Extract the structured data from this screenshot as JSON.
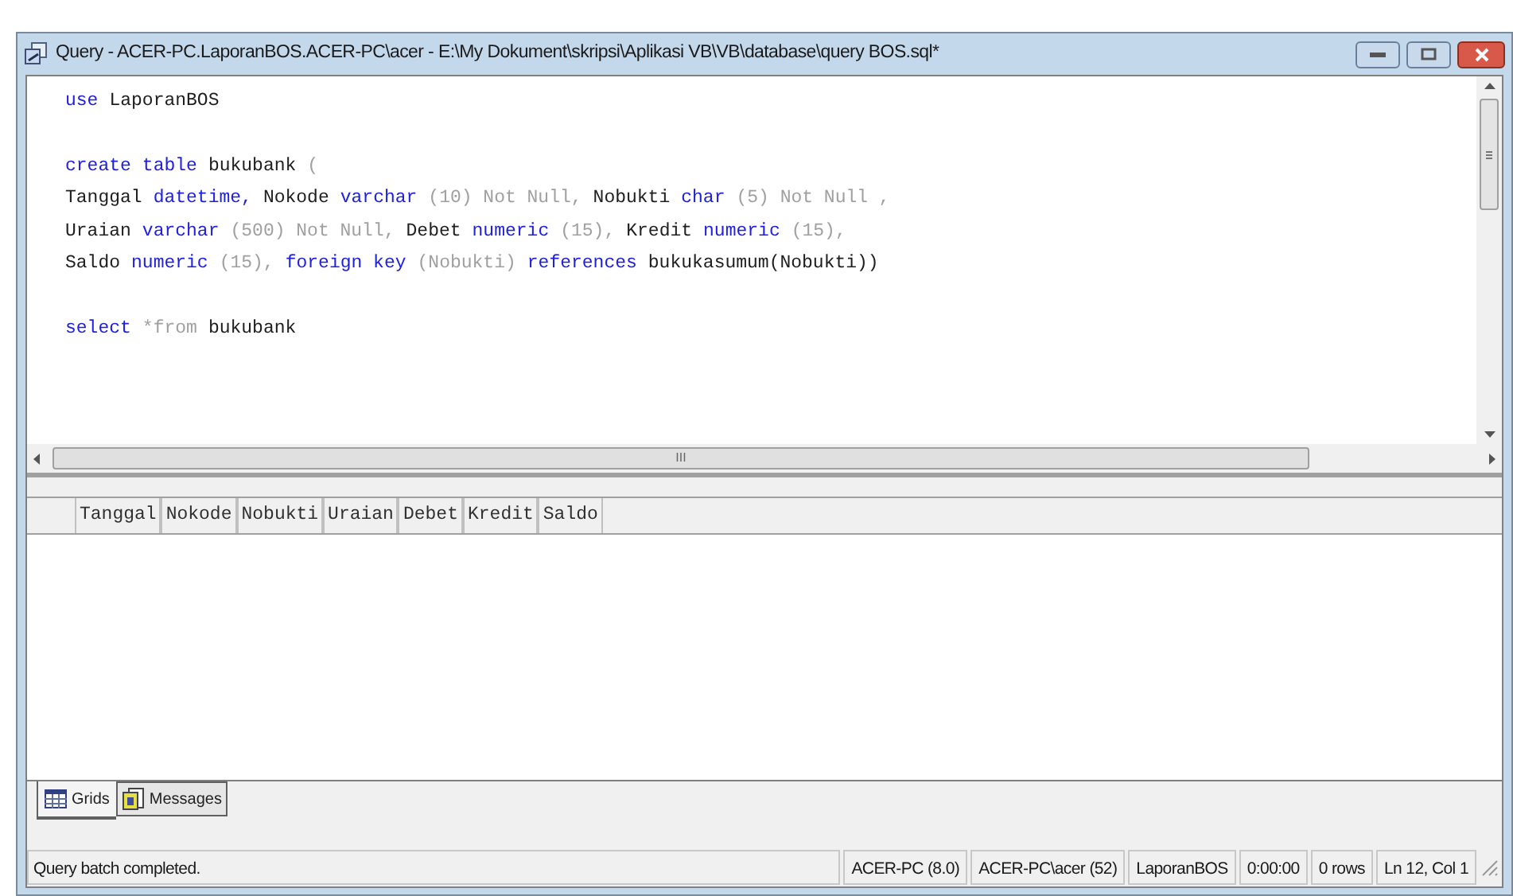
{
  "window": {
    "title": "Query - ACER-PC.LaporanBOS.ACER-PC\\acer - E:\\My Dokument\\skripsi\\Aplikasi VB\\VB\\database\\query BOS.sql*"
  },
  "editor": {
    "blocks": [
      [
        [
          {
            "kind": "kw",
            "text": "use"
          },
          {
            "kind": "id",
            "text": "LaporanBOS"
          }
        ]
      ],
      [
        [
          {
            "kind": "kw",
            "text": "create"
          },
          {
            "kind": "kw",
            "text": "table"
          },
          {
            "kind": "id",
            "text": "bukubank"
          },
          {
            "kind": "gray",
            "text": "("
          }
        ],
        [
          {
            "kind": "id",
            "text": "Tanggal"
          },
          {
            "kind": "kw",
            "text": "datetime,"
          },
          {
            "kind": "id",
            "text": "Nokode"
          },
          {
            "kind": "kw",
            "text": "varchar"
          },
          {
            "kind": "gray",
            "text": "(10) Not Null,"
          },
          {
            "kind": "id",
            "text": "Nobukti"
          },
          {
            "kind": "kw",
            "text": "char"
          },
          {
            "kind": "gray",
            "text": "(5) Not Null ,"
          }
        ],
        [
          {
            "kind": "id",
            "text": "Uraian"
          },
          {
            "kind": "kw",
            "text": "varchar"
          },
          {
            "kind": "gray",
            "text": "(500) Not Null,"
          },
          {
            "kind": "id",
            "text": "Debet"
          },
          {
            "kind": "kw",
            "text": "numeric"
          },
          {
            "kind": "gray",
            "text": "(15),"
          },
          {
            "kind": "id",
            "text": "Kredit"
          },
          {
            "kind": "kw",
            "text": "numeric"
          },
          {
            "kind": "gray",
            "text": "(15),"
          }
        ],
        [
          {
            "kind": "id",
            "text": "Saldo"
          },
          {
            "kind": "kw",
            "text": "numeric"
          },
          {
            "kind": "gray",
            "text": "(15),"
          },
          {
            "kind": "kw",
            "text": "foreign key"
          },
          {
            "kind": "gray",
            "text": "(Nobukti)"
          },
          {
            "kind": "kw",
            "text": "references"
          },
          {
            "kind": "id",
            "text": "bukukasumum(Nobukti))"
          }
        ]
      ],
      [
        [
          {
            "kind": "kw",
            "text": "select"
          },
          {
            "kind": "gray",
            "text": "*from"
          },
          {
            "kind": "id",
            "text": "bukubank"
          }
        ]
      ]
    ],
    "scroll_mark": "III"
  },
  "results": {
    "columns": [
      "Tanggal",
      "Nokode",
      "Nobukti",
      "Uraian",
      "Debet",
      "Kredit",
      "Saldo"
    ]
  },
  "tabs": [
    {
      "label": "Grids",
      "selected": true
    },
    {
      "label": "Messages",
      "selected": false
    }
  ],
  "status_bar": {
    "message": "Query batch completed.",
    "panels": [
      "ACER-PC (8.0)",
      "ACER-PC\\acer (52)",
      "LaporanBOS",
      "0:00:00",
      "0 rows",
      "Ln 12, Col 1"
    ]
  }
}
